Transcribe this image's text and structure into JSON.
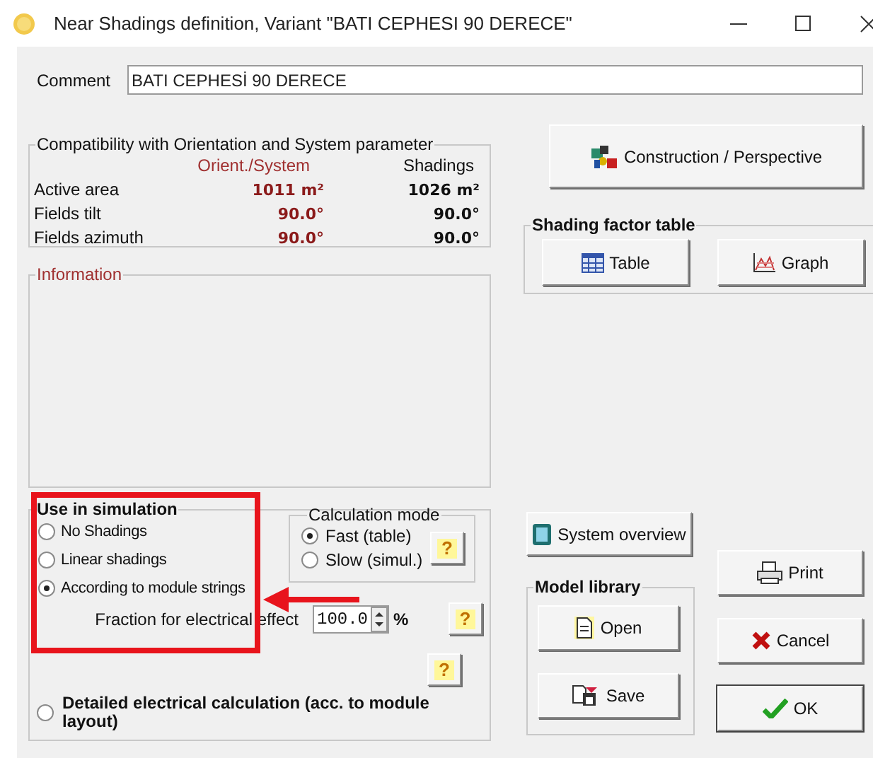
{
  "window": {
    "title": "Near Shadings definition, Variant \"BATI CEPHESI 90 DERECE\""
  },
  "comment": {
    "label": "Comment",
    "value": "BATI CEPHESİ 90 DERECE"
  },
  "compatibility": {
    "title": "Compatibility with Orientation and System parameter",
    "columns": [
      "Orient./System",
      "Shadings"
    ],
    "rows": [
      {
        "label": "Active area",
        "orient": "1011 m²",
        "shadings": "1026 m²"
      },
      {
        "label": "Fields tilt",
        "orient": "90.0°",
        "shadings": "90.0°"
      },
      {
        "label": "Fields azimuth",
        "orient": "90.0°",
        "shadings": "90.0°"
      }
    ]
  },
  "information": {
    "title": "Information"
  },
  "use_in_simulation": {
    "title": "Use in simulation",
    "options": [
      {
        "label": "No Shadings",
        "selected": false
      },
      {
        "label": "Linear shadings",
        "selected": false
      },
      {
        "label": "According to module strings",
        "selected": true
      }
    ],
    "calculation_mode": {
      "title": "Calculation mode",
      "options": [
        {
          "label": "Fast (table)",
          "selected": true
        },
        {
          "label": "Slow (simul.)",
          "selected": false
        }
      ],
      "help": "?"
    },
    "fraction": {
      "label": "Fraction for electrical effect",
      "value": "100.0",
      "unit": "%",
      "help": "?"
    },
    "extra_help": "?",
    "detailed": {
      "label": "Detailed electrical calculation (acc. to module layout)",
      "selected": false
    }
  },
  "construction_button": "Construction / Perspective",
  "shading_factor_table": {
    "title": "Shading factor table",
    "buttons": [
      "Table",
      "Graph"
    ]
  },
  "system_overview_button": "System overview",
  "model_library": {
    "title": "Model library",
    "buttons": [
      "Open",
      "Save"
    ]
  },
  "print_button": "Print",
  "cancel_button": "Cancel",
  "ok_button": "OK"
}
